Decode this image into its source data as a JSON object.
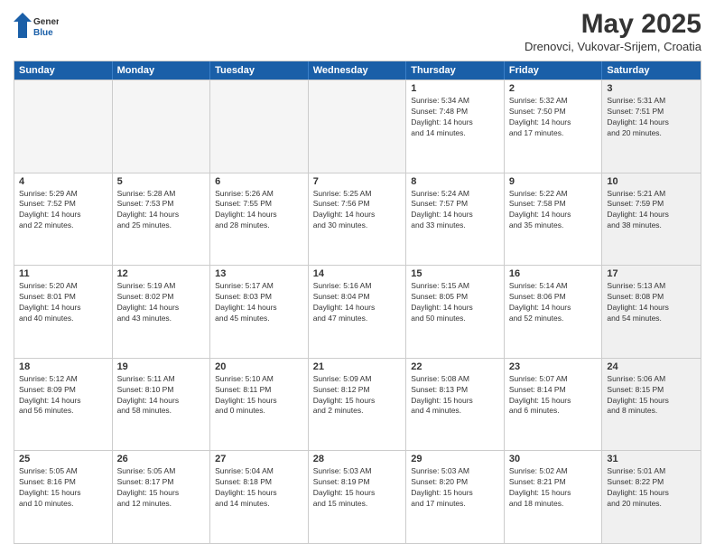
{
  "logo": {
    "general": "General",
    "blue": "Blue"
  },
  "title": "May 2025",
  "location": "Drenovci, Vukovar-Srijem, Croatia",
  "days_of_week": [
    "Sunday",
    "Monday",
    "Tuesday",
    "Wednesday",
    "Thursday",
    "Friday",
    "Saturday"
  ],
  "rows": [
    [
      {
        "day": "",
        "text": "",
        "empty": true
      },
      {
        "day": "",
        "text": "",
        "empty": true
      },
      {
        "day": "",
        "text": "",
        "empty": true
      },
      {
        "day": "",
        "text": "",
        "empty": true
      },
      {
        "day": "1",
        "text": "Sunrise: 5:34 AM\nSunset: 7:48 PM\nDaylight: 14 hours\nand 14 minutes."
      },
      {
        "day": "2",
        "text": "Sunrise: 5:32 AM\nSunset: 7:50 PM\nDaylight: 14 hours\nand 17 minutes."
      },
      {
        "day": "3",
        "text": "Sunrise: 5:31 AM\nSunset: 7:51 PM\nDaylight: 14 hours\nand 20 minutes.",
        "shaded": true
      }
    ],
    [
      {
        "day": "4",
        "text": "Sunrise: 5:29 AM\nSunset: 7:52 PM\nDaylight: 14 hours\nand 22 minutes."
      },
      {
        "day": "5",
        "text": "Sunrise: 5:28 AM\nSunset: 7:53 PM\nDaylight: 14 hours\nand 25 minutes."
      },
      {
        "day": "6",
        "text": "Sunrise: 5:26 AM\nSunset: 7:55 PM\nDaylight: 14 hours\nand 28 minutes."
      },
      {
        "day": "7",
        "text": "Sunrise: 5:25 AM\nSunset: 7:56 PM\nDaylight: 14 hours\nand 30 minutes."
      },
      {
        "day": "8",
        "text": "Sunrise: 5:24 AM\nSunset: 7:57 PM\nDaylight: 14 hours\nand 33 minutes."
      },
      {
        "day": "9",
        "text": "Sunrise: 5:22 AM\nSunset: 7:58 PM\nDaylight: 14 hours\nand 35 minutes."
      },
      {
        "day": "10",
        "text": "Sunrise: 5:21 AM\nSunset: 7:59 PM\nDaylight: 14 hours\nand 38 minutes.",
        "shaded": true
      }
    ],
    [
      {
        "day": "11",
        "text": "Sunrise: 5:20 AM\nSunset: 8:01 PM\nDaylight: 14 hours\nand 40 minutes."
      },
      {
        "day": "12",
        "text": "Sunrise: 5:19 AM\nSunset: 8:02 PM\nDaylight: 14 hours\nand 43 minutes."
      },
      {
        "day": "13",
        "text": "Sunrise: 5:17 AM\nSunset: 8:03 PM\nDaylight: 14 hours\nand 45 minutes."
      },
      {
        "day": "14",
        "text": "Sunrise: 5:16 AM\nSunset: 8:04 PM\nDaylight: 14 hours\nand 47 minutes."
      },
      {
        "day": "15",
        "text": "Sunrise: 5:15 AM\nSunset: 8:05 PM\nDaylight: 14 hours\nand 50 minutes."
      },
      {
        "day": "16",
        "text": "Sunrise: 5:14 AM\nSunset: 8:06 PM\nDaylight: 14 hours\nand 52 minutes."
      },
      {
        "day": "17",
        "text": "Sunrise: 5:13 AM\nSunset: 8:08 PM\nDaylight: 14 hours\nand 54 minutes.",
        "shaded": true
      }
    ],
    [
      {
        "day": "18",
        "text": "Sunrise: 5:12 AM\nSunset: 8:09 PM\nDaylight: 14 hours\nand 56 minutes."
      },
      {
        "day": "19",
        "text": "Sunrise: 5:11 AM\nSunset: 8:10 PM\nDaylight: 14 hours\nand 58 minutes."
      },
      {
        "day": "20",
        "text": "Sunrise: 5:10 AM\nSunset: 8:11 PM\nDaylight: 15 hours\nand 0 minutes."
      },
      {
        "day": "21",
        "text": "Sunrise: 5:09 AM\nSunset: 8:12 PM\nDaylight: 15 hours\nand 2 minutes."
      },
      {
        "day": "22",
        "text": "Sunrise: 5:08 AM\nSunset: 8:13 PM\nDaylight: 15 hours\nand 4 minutes."
      },
      {
        "day": "23",
        "text": "Sunrise: 5:07 AM\nSunset: 8:14 PM\nDaylight: 15 hours\nand 6 minutes."
      },
      {
        "day": "24",
        "text": "Sunrise: 5:06 AM\nSunset: 8:15 PM\nDaylight: 15 hours\nand 8 minutes.",
        "shaded": true
      }
    ],
    [
      {
        "day": "25",
        "text": "Sunrise: 5:05 AM\nSunset: 8:16 PM\nDaylight: 15 hours\nand 10 minutes."
      },
      {
        "day": "26",
        "text": "Sunrise: 5:05 AM\nSunset: 8:17 PM\nDaylight: 15 hours\nand 12 minutes."
      },
      {
        "day": "27",
        "text": "Sunrise: 5:04 AM\nSunset: 8:18 PM\nDaylight: 15 hours\nand 14 minutes."
      },
      {
        "day": "28",
        "text": "Sunrise: 5:03 AM\nSunset: 8:19 PM\nDaylight: 15 hours\nand 15 minutes."
      },
      {
        "day": "29",
        "text": "Sunrise: 5:03 AM\nSunset: 8:20 PM\nDaylight: 15 hours\nand 17 minutes."
      },
      {
        "day": "30",
        "text": "Sunrise: 5:02 AM\nSunset: 8:21 PM\nDaylight: 15 hours\nand 18 minutes."
      },
      {
        "day": "31",
        "text": "Sunrise: 5:01 AM\nSunset: 8:22 PM\nDaylight: 15 hours\nand 20 minutes.",
        "shaded": true
      }
    ]
  ]
}
